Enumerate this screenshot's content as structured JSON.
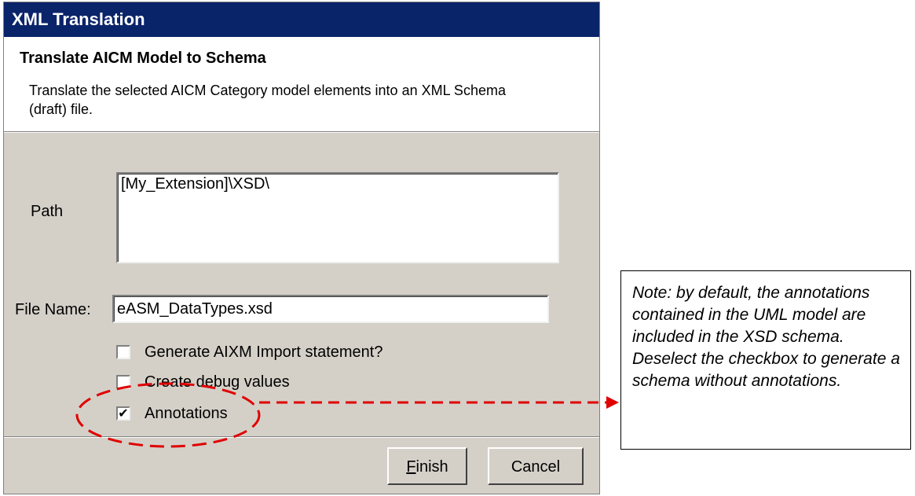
{
  "dialog": {
    "title": "XML Translation",
    "header_title": "Translate AICM Model to Schema",
    "header_description": "Translate the selected AICM Category model elements into an XML Schema (draft) file."
  },
  "form": {
    "path_label": "Path",
    "path_value": "[My_Extension]\\XSD\\",
    "filename_label": "File Name:",
    "filename_value": "eASM_DataTypes.xsd",
    "checkboxes": [
      {
        "label": "Generate AIXM Import statement?",
        "checked": false
      },
      {
        "label": "Create debug values",
        "checked": false
      },
      {
        "label": "Annotations",
        "checked": true
      }
    ]
  },
  "buttons": {
    "finish": "Finish",
    "cancel": "Cancel"
  },
  "annotation": {
    "note_text": "Note: by default, the annotations contained in the UML model are included in the XSD schema. Deselect the checkbox to generate a schema without annotations.",
    "highlight_color": "#e00000"
  }
}
